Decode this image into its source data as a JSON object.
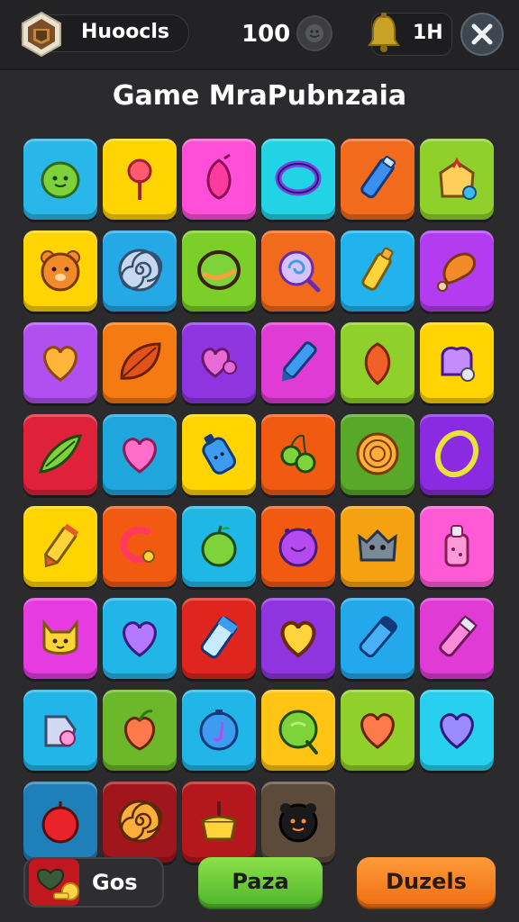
{
  "header": {
    "profile_name": "Huoocls",
    "score": "100",
    "notification_count": "1H"
  },
  "title": "Game MraPubnzaia",
  "grid": {
    "columns": 6,
    "tiles": [
      {
        "color": "#29b6e8",
        "icon": "green-blob-icon"
      },
      {
        "color": "#ffd400",
        "icon": "lollipop-icon"
      },
      {
        "color": "#ff4fd8",
        "icon": "pink-seed-icon"
      },
      {
        "color": "#22d3e6",
        "icon": "purple-ring-icon"
      },
      {
        "color": "#f26a1b",
        "icon": "blue-bottle-icon"
      },
      {
        "color": "#8fd12a",
        "icon": "bag-icon"
      },
      {
        "color": "#ffd400",
        "icon": "bear-face-icon"
      },
      {
        "color": "#25a9e6",
        "icon": "spiral-icon"
      },
      {
        "color": "#7ccf28",
        "icon": "green-ball-icon"
      },
      {
        "color": "#f26a1b",
        "icon": "purple-swirl-icon"
      },
      {
        "color": "#22b2ee",
        "icon": "yellow-bottle-icon"
      },
      {
        "color": "#b43cf0",
        "icon": "drumstick-icon"
      },
      {
        "color": "#b14ff0",
        "icon": "heart-icon"
      },
      {
        "color": "#f57a12",
        "icon": "leaf-icon"
      },
      {
        "color": "#8e35e0",
        "icon": "heart-ball-icon"
      },
      {
        "color": "#e13bd6",
        "icon": "blue-pen-icon"
      },
      {
        "color": "#8fd12a",
        "icon": "orange-drop-icon"
      },
      {
        "color": "#ffd400",
        "icon": "purple-bag-icon"
      },
      {
        "color": "#e0213a",
        "icon": "green-pod-icon"
      },
      {
        "color": "#1fa6dc",
        "icon": "pink-heart-icon"
      },
      {
        "color": "#ffd400",
        "icon": "blue-bottle-face-icon"
      },
      {
        "color": "#f25a12",
        "icon": "green-cherries-icon"
      },
      {
        "color": "#58a82a",
        "icon": "wood-swirl-icon"
      },
      {
        "color": "#8a2be2",
        "icon": "yellow-ring-icon"
      },
      {
        "color": "#ffd400",
        "icon": "crayon-icon"
      },
      {
        "color": "#f25a12",
        "icon": "magnet-icon"
      },
      {
        "color": "#1fb8e6",
        "icon": "green-apple-icon"
      },
      {
        "color": "#f25a12",
        "icon": "purple-blob-icon"
      },
      {
        "color": "#f5a212",
        "icon": "grey-monster-icon"
      },
      {
        "color": "#ff5ad6",
        "icon": "pink-bottle-icon"
      },
      {
        "color": "#e53be0",
        "icon": "yellow-cat-icon"
      },
      {
        "color": "#22b6e8",
        "icon": "purple-heart-icon"
      },
      {
        "color": "#e0241e",
        "icon": "blue-tube-icon"
      },
      {
        "color": "#8e35e0",
        "icon": "yellow-heart-icon"
      },
      {
        "color": "#23a8ec",
        "icon": "blue-pen2-icon"
      },
      {
        "color": "#e13bd6",
        "icon": "pink-pen-icon"
      },
      {
        "color": "#22b6e8",
        "icon": "tooth-face-icon"
      },
      {
        "color": "#6cb82a",
        "icon": "orange-apple-icon"
      },
      {
        "color": "#22b6e8",
        "icon": "blue-orb-icon"
      },
      {
        "color": "#ffc414",
        "icon": "green-orb-icon"
      },
      {
        "color": "#8fd12a",
        "icon": "orange-heart-icon"
      },
      {
        "color": "#26d0ee",
        "icon": "lilac-heart-icon"
      },
      {
        "color": "#1f7fb8",
        "icon": "red-apple-icon"
      },
      {
        "color": "#a0161c",
        "icon": "orange-spiral-icon"
      },
      {
        "color": "#b5181c",
        "icon": "cake-icon"
      },
      {
        "color": "#5c4a3a",
        "icon": "dark-monster-icon"
      }
    ]
  },
  "bottom": {
    "gos_label": "Gos",
    "paza_label": "Paza",
    "duzels_label": "Duzels"
  }
}
